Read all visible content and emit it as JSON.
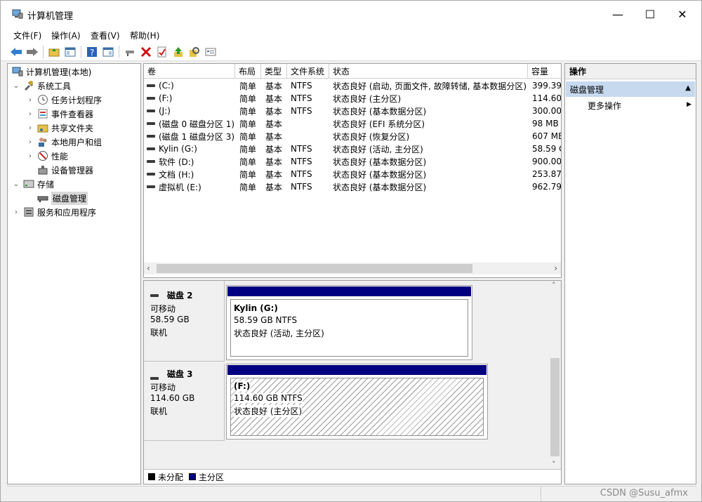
{
  "window": {
    "title": "计算机管理"
  },
  "menu": [
    "文件(F)",
    "操作(A)",
    "查看(V)",
    "帮助(H)"
  ],
  "toolbar": {
    "buttons": [
      "back-icon",
      "forward-icon",
      "up-folder-icon",
      "show-hide-tree-icon",
      "help-icon",
      "properties-view-icon",
      "connect-icon",
      "delete-icon",
      "check-icon",
      "export-up-icon",
      "search-icon",
      "settings-list-icon"
    ]
  },
  "tree": {
    "root": "计算机管理(本地)",
    "system_tools": "系统工具",
    "task_scheduler": "任务计划程序",
    "event_viewer": "事件查看器",
    "shared_folders": "共享文件夹",
    "local_users": "本地用户和组",
    "performance": "性能",
    "device_manager": "设备管理器",
    "storage": "存储",
    "disk_management": "磁盘管理",
    "services": "服务和应用程序"
  },
  "columns": [
    "卷",
    "布局",
    "类型",
    "文件系统",
    "状态",
    "容量"
  ],
  "volumes": [
    [
      "(C:)",
      "简单",
      "基本",
      "NTFS",
      "状态良好 (启动, 页面文件, 故障转储, 基本数据分区)",
      "399.39"
    ],
    [
      "(F:)",
      "简单",
      "基本",
      "NTFS",
      "状态良好 (主分区)",
      "114.60"
    ],
    [
      "(J:)",
      "简单",
      "基本",
      "NTFS",
      "状态良好 (基本数据分区)",
      "300.00"
    ],
    [
      "(磁盘 0 磁盘分区 1)",
      "简单",
      "基本",
      "",
      "状态良好 (EFI 系统分区)",
      "98 MB"
    ],
    [
      "(磁盘 1 磁盘分区 3)",
      "简单",
      "基本",
      "",
      "状态良好 (恢复分区)",
      "607 MB"
    ],
    [
      "Kylin (G:)",
      "简单",
      "基本",
      "NTFS",
      "状态良好 (活动, 主分区)",
      "58.59 G"
    ],
    [
      "软件 (D:)",
      "简单",
      "基本",
      "NTFS",
      "状态良好 (基本数据分区)",
      "900.00"
    ],
    [
      "文档 (H:)",
      "简单",
      "基本",
      "NTFS",
      "状态良好 (基本数据分区)",
      "253.87"
    ],
    [
      "虚拟机 (E:)",
      "简单",
      "基本",
      "NTFS",
      "状态良好 (基本数据分区)",
      "962.79"
    ]
  ],
  "disks": [
    {
      "name": "磁盘 2",
      "type": "可移动",
      "size": "58.59 GB",
      "state": "联机",
      "partition": {
        "label": "Kylin  (G:)",
        "size": "58.59 GB NTFS",
        "status": "状态良好 (活动, 主分区)"
      }
    },
    {
      "name": "磁盘 3",
      "type": "可移动",
      "size": "114.60 GB",
      "state": "联机",
      "partition": {
        "label": "(F:)",
        "size": "114.60 GB NTFS",
        "status": "状态良好 (主分区)"
      }
    }
  ],
  "legend": {
    "unallocated": "未分配",
    "primary": "主分区",
    "unallocated_color": "#000000",
    "primary_color": "#000080"
  },
  "actions": {
    "header": "操作",
    "section": "磁盘管理",
    "more": "更多操作"
  },
  "watermark": "CSDN @Susu_afmx"
}
